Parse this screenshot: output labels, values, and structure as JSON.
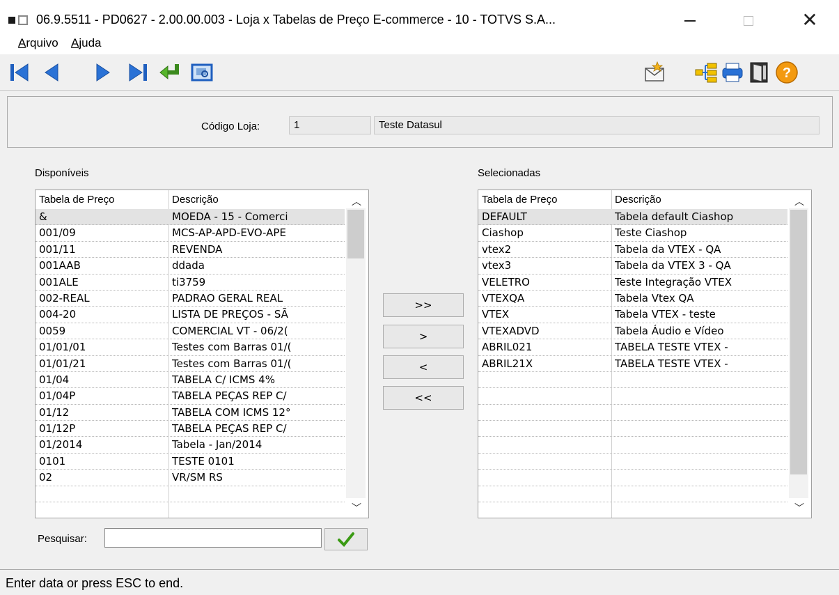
{
  "window": {
    "title": "06.9.5511 - PD0627 - 2.00.00.003 - Loja x Tabelas de Preço E-commerce - 10 - TOTVS S.A...",
    "close_glyph": "✕"
  },
  "menu": {
    "arquivo_first": "A",
    "arquivo_rest": "rquivo",
    "ajuda_first": "A",
    "ajuda_rest": "juda"
  },
  "toolbar": {
    "icons": [
      "first-record-icon",
      "prev-record-icon",
      "next-record-icon",
      "last-record-icon",
      "go-to-icon",
      "search-zoom-icon",
      "mail-icon",
      "tree-icon",
      "print-icon",
      "exit-door-icon",
      "help-icon"
    ],
    "help_glyph": "?"
  },
  "header": {
    "codigo_label": "Código Loja:",
    "codigo_value": "1",
    "descricao_value": "Teste Datasul"
  },
  "disponiveis": {
    "label": "Disponíveis",
    "col1": "Tabela de Preço",
    "col2": "Descrição",
    "rows": [
      {
        "tabela": "&",
        "descricao": "MOEDA - 15 - Comerci"
      },
      {
        "tabela": "001/09",
        "descricao": "MCS-AP-APD-EVO-APE"
      },
      {
        "tabela": "001/11",
        "descricao": "REVENDA"
      },
      {
        "tabela": "001AAB",
        "descricao": "ddada"
      },
      {
        "tabela": "001ALE",
        "descricao": "ti3759"
      },
      {
        "tabela": "002-REAL",
        "descricao": "PADRAO GERAL REAL"
      },
      {
        "tabela": "004-20",
        "descricao": "LISTA DE PREÇOS - SÃ"
      },
      {
        "tabela": "0059",
        "descricao": "COMERCIAL VT - 06/2("
      },
      {
        "tabela": "01/01/01",
        "descricao": "Testes com Barras 01/("
      },
      {
        "tabela": "01/01/21",
        "descricao": "Testes com Barras 01/("
      },
      {
        "tabela": "01/04",
        "descricao": "TABELA C/ ICMS 4%"
      },
      {
        "tabela": "01/04P",
        "descricao": "TABELA PEÇAS REP C/"
      },
      {
        "tabela": "01/12",
        "descricao": "TABELA COM ICMS 12°"
      },
      {
        "tabela": "01/12P",
        "descricao": "TABELA PEÇAS REP C/"
      },
      {
        "tabela": "01/2014",
        "descricao": "Tabela - Jan/2014"
      },
      {
        "tabela": "0101",
        "descricao": "TESTE 0101"
      },
      {
        "tabela": "02",
        "descricao": "VR/SM RS"
      },
      {
        "tabela": "",
        "descricao": ""
      }
    ]
  },
  "selecionadas": {
    "label": "Selecionadas",
    "col1": "Tabela de Preço",
    "col2": "Descrição",
    "rows": [
      {
        "tabela": "DEFAULT",
        "descricao": "Tabela default Ciashop"
      },
      {
        "tabela": "Ciashop",
        "descricao": "Teste Ciashop"
      },
      {
        "tabela": "vtex2",
        "descricao": "Tabela da VTEX - QA"
      },
      {
        "tabela": "vtex3",
        "descricao": "Tabela da VTEX 3 - QA"
      },
      {
        "tabela": "VELETRO",
        "descricao": "Teste Integração VTEX"
      },
      {
        "tabela": "VTEXQA",
        "descricao": "Tabela Vtex QA"
      },
      {
        "tabela": "VTEX",
        "descricao": "Tabela VTEX - teste"
      },
      {
        "tabela": "VTEXADVD",
        "descricao": "Tabela Áudio e Vídeo"
      },
      {
        "tabela": "ABRIL021",
        "descricao": "TABELA TESTE VTEX -"
      },
      {
        "tabela": "ABRIL21X",
        "descricao": "TABELA TESTE VTEX -"
      },
      {
        "tabela": "",
        "descricao": ""
      },
      {
        "tabela": "",
        "descricao": ""
      },
      {
        "tabela": "",
        "descricao": ""
      },
      {
        "tabela": "",
        "descricao": ""
      },
      {
        "tabela": "",
        "descricao": ""
      },
      {
        "tabela": "",
        "descricao": ""
      },
      {
        "tabela": "",
        "descricao": ""
      },
      {
        "tabela": "",
        "descricao": ""
      }
    ]
  },
  "transfer": {
    "add_all": ">>",
    "add": ">",
    "remove": "<",
    "remove_all": "<<"
  },
  "search": {
    "label": "Pesquisar:",
    "value": ""
  },
  "status": {
    "text": "Enter data or press ESC to end."
  }
}
